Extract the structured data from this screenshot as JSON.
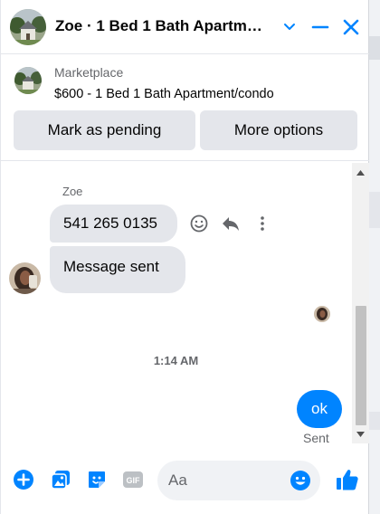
{
  "header": {
    "title": "Zoe · 1 Bed 1 Bath Apartm…",
    "icons": [
      "house-avatar",
      "chevron-down-icon",
      "minimize-icon",
      "close-icon"
    ]
  },
  "listing": {
    "label": "Marketplace",
    "item": "$600 - 1 Bed 1 Bath Apartment/condo",
    "mark_pending_label": "Mark as pending",
    "more_options_label": "More options"
  },
  "thread": {
    "sender_name": "Zoe",
    "messages_in": [
      "541 265 0135",
      "Message sent"
    ],
    "timestamp": "1:14 AM",
    "message_out": "ok",
    "sent_status": "Sent"
  },
  "composer": {
    "placeholder": "Aa",
    "icons": [
      "plus-icon",
      "photo-icon",
      "sticker-icon",
      "gif-icon",
      "emoji-icon",
      "thumbs-up-icon"
    ]
  },
  "colors": {
    "accent": "#0084ff",
    "bubble_in": "#e4e6eb",
    "muted_text": "#65676b"
  }
}
